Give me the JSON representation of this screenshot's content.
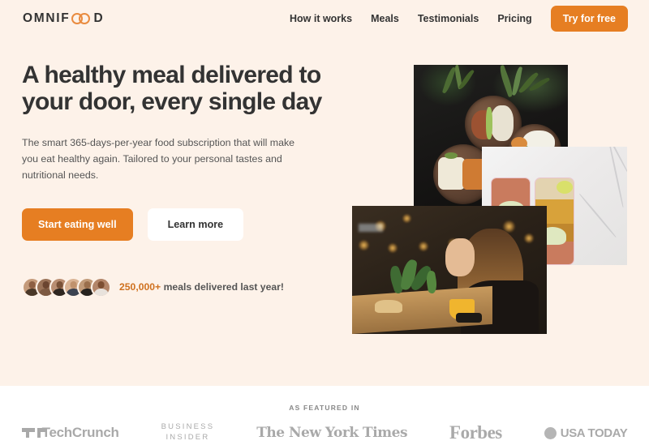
{
  "header": {
    "logo_text_before": "OMNIF",
    "logo_icon": "infinity-icon",
    "logo_text_after": "D",
    "logo_full": "OMNIFOOD",
    "nav": [
      {
        "label": "How it works"
      },
      {
        "label": "Meals"
      },
      {
        "label": "Testimonials"
      },
      {
        "label": "Pricing"
      }
    ],
    "cta_label": "Try for free"
  },
  "hero": {
    "title": "A healthy meal delivered to your door, every single day",
    "description": "The smart 365-days-per-year food subscription that will make you eat healthy again. Tailored to your personal tastes and nutritional needs.",
    "primary_button": "Start eating well",
    "secondary_button": "Learn more",
    "delivered": {
      "count": "250,000+",
      "text": " meals delivered last year!",
      "avatar_count": 6
    },
    "images": [
      {
        "name": "bowls-of-food",
        "alt": "Three dark bowls of healthy food on a table with plants"
      },
      {
        "name": "meal-prep-containers",
        "alt": "Two meal prep containers with chickpeas and salad on marble"
      },
      {
        "name": "woman-eating",
        "alt": "Woman eating a healthy meal at a restaurant"
      }
    ]
  },
  "featured": {
    "heading": "AS FEATURED IN",
    "brands": [
      {
        "name": "TechCrunch",
        "label": "TechCrunch"
      },
      {
        "name": "Business Insider",
        "line1": "BUSINESS",
        "line2": "INSIDER"
      },
      {
        "name": "The New York Times",
        "label": "The New York Times"
      },
      {
        "name": "Forbes",
        "label": "Forbes"
      },
      {
        "name": "USA Today",
        "label": "USA TODAY"
      }
    ]
  },
  "colors": {
    "accent": "#e67e22",
    "accent_dark": "#cf711f",
    "hero_bg": "#fdf2e9",
    "text": "#333333",
    "text_muted": "#555555"
  }
}
